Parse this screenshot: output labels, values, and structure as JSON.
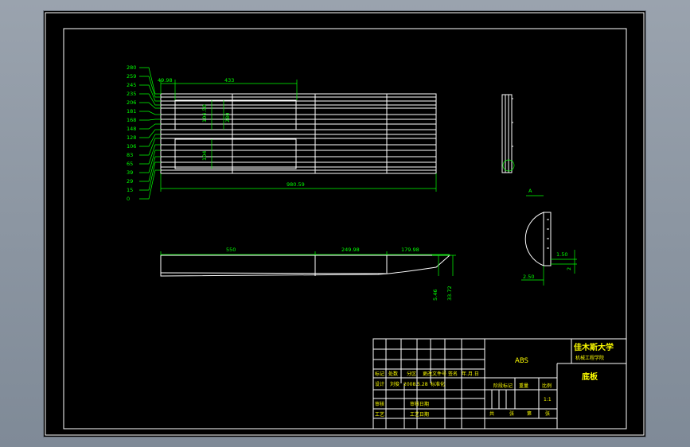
{
  "colors": {
    "background": "#000000",
    "outline": "#ffffff",
    "dimension": "#00ff00",
    "title_text": "#ffff00"
  },
  "dims": {
    "left_stack": [
      "280",
      "259",
      "245",
      "235",
      "206",
      "181",
      "168",
      "148",
      "128",
      "106",
      "83",
      "65",
      "39",
      "29",
      "15",
      "0"
    ],
    "top_a": "49.98",
    "top_b": "433",
    "inner_a": "104.50",
    "inner_b": "280",
    "inner_c": "104",
    "overall": "980.59",
    "side_a": "550",
    "side_b": "249.98",
    "side_c": "179.98",
    "v_a": "5.46",
    "v_b": "33.72",
    "detail_a": "1.50",
    "detail_b": "2.50",
    "detail_c": "2",
    "detail_mark": "A"
  },
  "title_block": {
    "material": "ABS",
    "university": "佳木斯大学",
    "college": "机械工程学院",
    "part_name": "底板",
    "row_labels": [
      "标记",
      "处数",
      "分区",
      "更改文件号",
      "签名",
      "年.月.日"
    ],
    "design": "设计",
    "designer": "刘俊",
    "design_date": "2008.5.28",
    "standard": "标准化",
    "stage": "阶段标记",
    "weight": "重量",
    "scale": "比例",
    "scale_val": "1:1",
    "review": "审核",
    "review_date": "审核日期",
    "process": "工艺",
    "process_date": "工艺日期",
    "sheets_total": "共",
    "sheets_label": "张",
    "sheet_num": "第",
    "sheet_label": "张"
  }
}
